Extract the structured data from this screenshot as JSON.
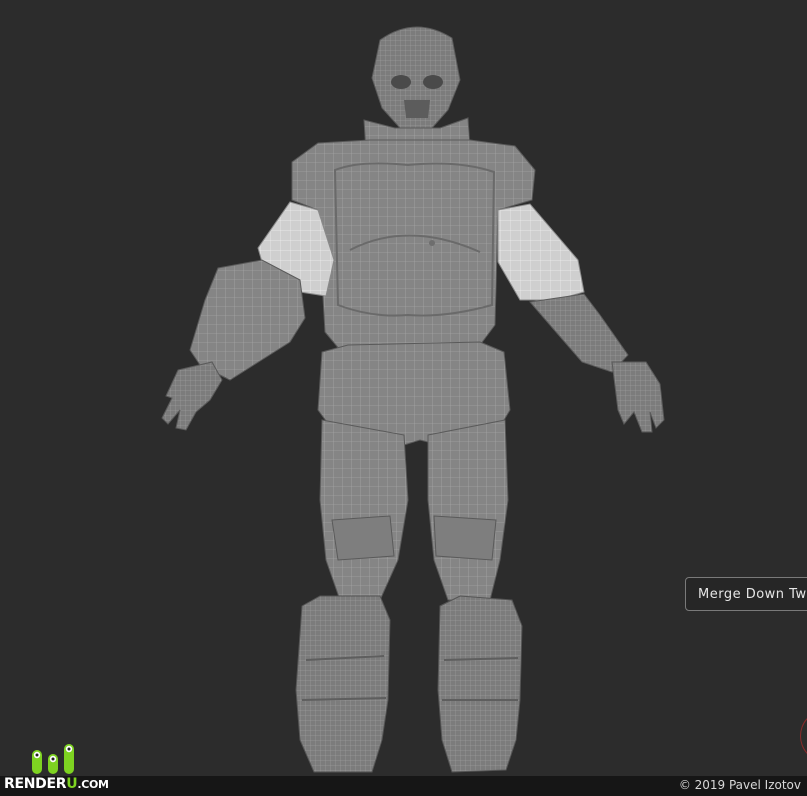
{
  "tooltip": {
    "label": "Merge Down Tw"
  },
  "watermark": {
    "copyright": "© 2019 Pavel Izotov"
  },
  "logo": {
    "part1": "RENDER",
    "accent": "U",
    "part2": ".COM",
    "accent_color": "#7ed321"
  },
  "colors": {
    "background": "#2c2c2c",
    "mesh": "#8a8a8a",
    "mesh_light": "#c9c9c9",
    "wire": "#b8b8b8"
  }
}
